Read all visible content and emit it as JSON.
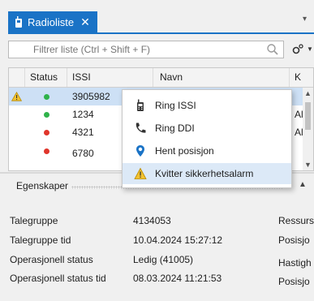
{
  "tab": {
    "title": "Radioliste",
    "close_glyph": "✕",
    "icon": "radio-icon",
    "accent": "#1a73c6"
  },
  "filter": {
    "placeholder": "Filtrer liste (Ctrl + Shift + F)"
  },
  "grid": {
    "columns": [
      "Status",
      "ISSI",
      "Navn",
      "K"
    ],
    "rows": [
      {
        "warning": true,
        "status_color": "#2fb24a",
        "issi": "3905982",
        "k": ""
      },
      {
        "warning": false,
        "status_color": "#2fb24a",
        "issi": "1234",
        "k": "Al"
      },
      {
        "warning": false,
        "status_color": "#e0352b",
        "issi": "4321",
        "k": "Al"
      },
      {
        "warning": false,
        "status_color": "#e0352b",
        "issi": "6780",
        "k": ""
      }
    ]
  },
  "context_menu": {
    "items": [
      {
        "label": "Ring ISSI",
        "icon": "radio-handset-icon"
      },
      {
        "label": "Ring DDI",
        "icon": "phone-icon"
      },
      {
        "label": "Hent posisjon",
        "icon": "location-pin-icon"
      },
      {
        "label": "Kvitter sikkerhetsalarm",
        "icon": "warning-icon"
      }
    ]
  },
  "properties": {
    "title": "Egenskaper",
    "left": [
      {
        "label": "Talegruppe",
        "value": "4134053"
      },
      {
        "label": "Talegruppe tid",
        "value": "10.04.2024 15:27:12"
      },
      {
        "label": "Operasjonell status",
        "value": "Ledig (41005)"
      },
      {
        "label": "Operasjonell status tid",
        "value": "08.03.2024 11:21:53"
      }
    ],
    "right": [
      "Ressurs",
      "Posisjo",
      "Hastigh",
      "Posisjo"
    ]
  }
}
